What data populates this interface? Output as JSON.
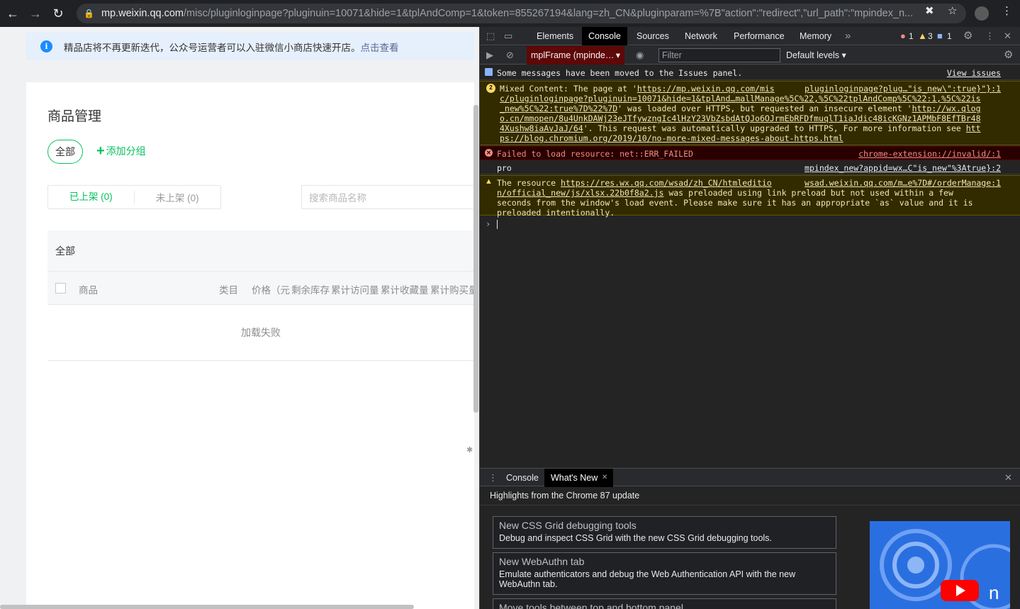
{
  "browser": {
    "url_host": "mp.weixin.qq.com",
    "url_rest": "/misc/pluginloginpage?pluginuin=10071&hide=1&tplAndComp=1&token=855267194&lang=zh_CN&pluginparam=%7B\"action\":\"redirect\",\"url_path\":\"mpindex_n..."
  },
  "page": {
    "notice_text": "精品店将不再更新迭代，公众号运营者可以入驻微信小商店快速开店。",
    "notice_link": "点击查看",
    "title": "商品管理",
    "group_all": "全部",
    "add_group": "添加分组",
    "seg_on": "已上架 (0)",
    "seg_off": "未上架 (0)",
    "search_placeholder": "搜索商品名称",
    "table_group": "全部",
    "columns": [
      "商品",
      "类目",
      "价格（元",
      "剩余库存",
      "累计访问量",
      "累计收藏量",
      "累计购买量"
    ],
    "empty": "加载失败"
  },
  "devtools": {
    "tabs": [
      "Elements",
      "Console",
      "Sources",
      "Network",
      "Performance",
      "Memory"
    ],
    "active_tab": "Console",
    "more": "»",
    "errors": "1",
    "warnings": "3",
    "infos": "1",
    "context": "mplFrame (mpinde…",
    "filter_placeholder": "Filter",
    "levels": "Default levels ▾",
    "messages": {
      "m1_text": "Some messages have been moved to the Issues panel.",
      "m1_src": "View issues",
      "m2_count": "2",
      "m2_a": "Mixed Content: The page at '",
      "m2_link1": "https://mp.weixin.qq.com/mis",
      "m2_src": "pluginloginpage?plug…\"is_new\\\":true}\"}:1",
      "m2_l2": "c/pluginloginpage?pluginuin=10071&hide=1&tplAnd…mallManage%5C%22,%5C%22tplAndComp%5C%22:1,%5C%22is",
      "m2_l3a": "_new%5C%22:true%7D%22%7D",
      "m2_l3b": "' was loaded over HTTPS, but requested an insecure element '",
      "m2_l3c": "http://wx.qlog",
      "m2_l4": "o.cn/mmopen/8u4UnkDAWj23eJTfywzngIc4lHzY23VbZsbdAtQJo6OJrmEbRFDfmuqlT1iaJdic48icKGNz1APMbF8EfTBr48",
      "m2_l5a": "4Xushw8iaAvJaJ/64",
      "m2_l5b": "'. This request was automatically upgraded to HTTPS, For more information see ",
      "m2_l5c": "htt",
      "m2_l6": "ps://blog.chromium.org/2019/10/no-more-mixed-messages-about-https.html",
      "m3_text": "Failed to load resource: net::ERR_FAILED",
      "m3_src": "chrome-extension://invalid/:1",
      "m4_text": "pro",
      "m4_src": "mpindex_new?appid=wx…C\"is_new\"%3Atrue}:2",
      "m5_a": "The resource ",
      "m5_link1": "https://res.wx.qq.com/wsad/zh_CN/htmleditio",
      "m5_src": "wsad.weixin.qq.com/m…e%7D#/orderManage:1",
      "m5_l2a": "n/official_new/js/xlsx.22b0f8a2.js",
      "m5_l2b": " was preloaded using link preload but not used within a few",
      "m5_l3": "seconds from the window's load event. Please make sure it has an appropriate `as` value and it is",
      "m5_l4": "preloaded intentionally."
    },
    "drawer_tabs": [
      "Console",
      "What's New"
    ],
    "whats_new_header": "Highlights from the Chrome 87 update",
    "cards": [
      {
        "title": "New CSS Grid debugging tools",
        "desc": "Debug and inspect CSS Grid with the new CSS Grid debugging tools."
      },
      {
        "title": "New WebAuthn tab",
        "desc": "Emulate authenticators and debug the Web Authentication API with the new WebAuthn tab."
      },
      {
        "title": "Move tools between top and bottom panel",
        "desc": ""
      }
    ]
  },
  "colors": {
    "accent_green": "#07c160",
    "devtools_bg": "#242424",
    "error_red": "#f28b82",
    "warn_yellow": "#f1e6b3"
  }
}
